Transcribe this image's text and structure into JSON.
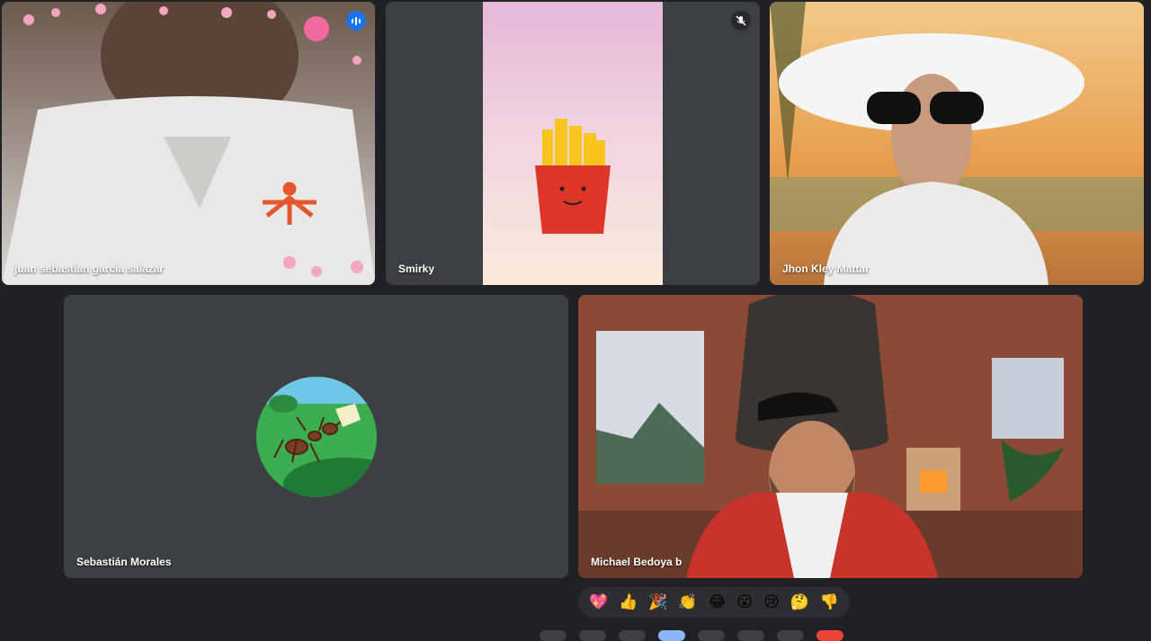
{
  "participants": [
    {
      "name": "juan sebastian garcia salazar",
      "state": "speaking"
    },
    {
      "name": "Smirky",
      "state": "muted"
    },
    {
      "name": "Jhon Kley Mattar",
      "state": "video"
    },
    {
      "name": "Sebastián Morales",
      "state": "avatar"
    },
    {
      "name": "Michael Bedoya b",
      "state": "video"
    }
  ],
  "reactions": [
    "💖",
    "👍",
    "🎉",
    "👏",
    "😂",
    "😮",
    "😢",
    "🤔",
    "👎"
  ],
  "colors": {
    "background": "#202124",
    "tile": "#3c4043",
    "active_border": "#8ab4f8",
    "speaking_badge": "#1a73e8"
  }
}
